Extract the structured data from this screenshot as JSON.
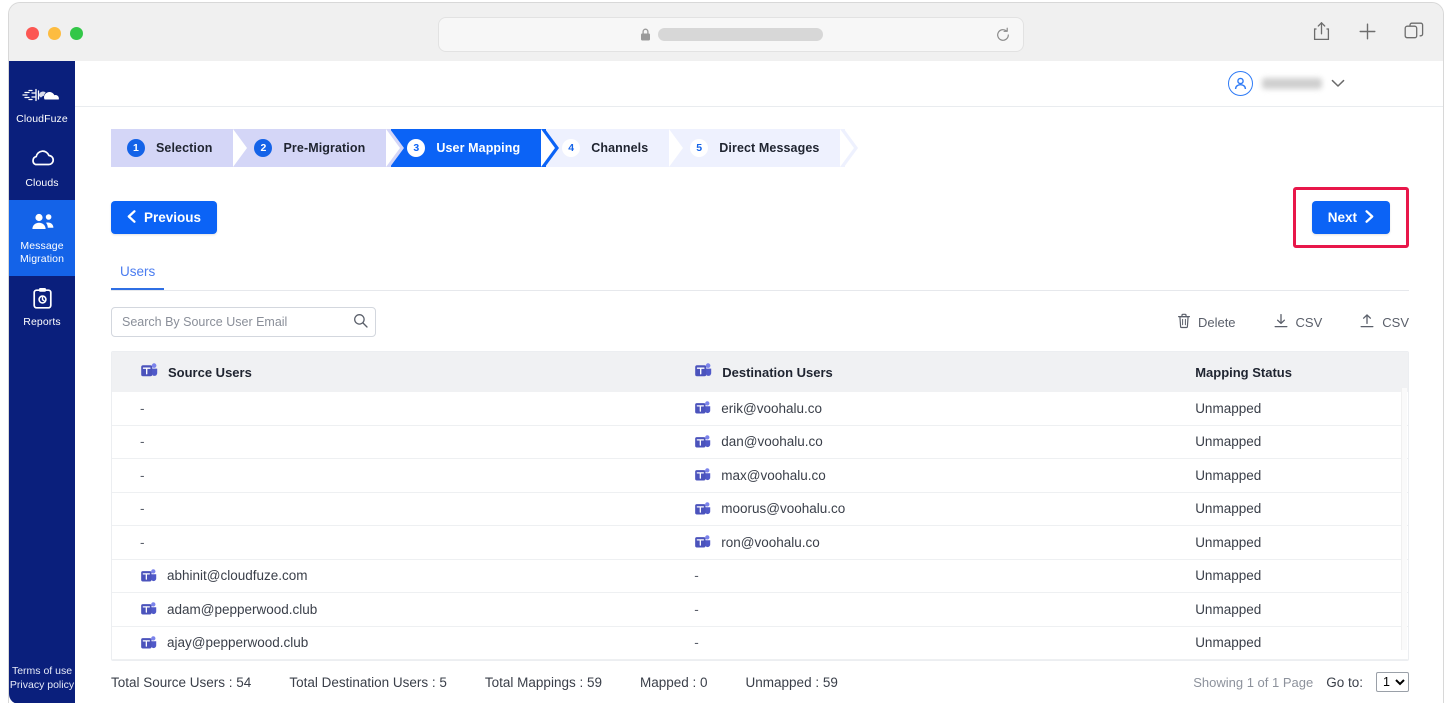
{
  "browser": {
    "traffic_lights": [
      "close-red",
      "minimize-amber",
      "maximize-green"
    ],
    "url_value": "",
    "url_redacted": true,
    "lock_icon": "lock-icon",
    "reload_icon": "reload-icon",
    "share_icon": "share-icon",
    "new_tab_icon": "plus-icon",
    "tabs_icon": "copy-tabs-icon"
  },
  "sidebar": {
    "brand": {
      "label": "CloudFuze",
      "icon": "cloudfuze-logo-icon"
    },
    "items": [
      {
        "label": "Clouds",
        "icon": "cloud-icon",
        "active": false
      },
      {
        "label": "Message\nMigration",
        "line1": "Message",
        "line2": "Migration",
        "icon": "users-group-icon",
        "active": true
      },
      {
        "label": "Reports",
        "icon": "clipboard-report-icon",
        "active": false
      }
    ],
    "legal": [
      "Terms of use",
      "Privacy policy"
    ],
    "bg_color": "#0a1f7c",
    "active_color": "#1463e8"
  },
  "header": {
    "profile": {
      "avatar_icon": "user-avatar-icon",
      "username": "",
      "username_redacted": true,
      "chevron": "chevron-down-icon"
    }
  },
  "stepper": {
    "steps": [
      {
        "num": "1",
        "label": "Selection",
        "state": "done"
      },
      {
        "num": "2",
        "label": "Pre-Migration",
        "state": "done"
      },
      {
        "num": "3",
        "label": "User Mapping",
        "state": "current"
      },
      {
        "num": "4",
        "label": "Channels",
        "state": "todo"
      },
      {
        "num": "5",
        "label": "Direct Messages",
        "state": "todo"
      }
    ],
    "colors": {
      "done": "#d4d6f7",
      "current": "#0b63f6",
      "todo": "#eef1fe",
      "accent": "#1463e8"
    }
  },
  "nav_buttons": {
    "previous_label": "Previous",
    "previous_icon": "chevron-left-icon",
    "next_label": "Next",
    "next_icon": "chevron-right-icon",
    "next_highlighted": true,
    "highlight_color": "#e8174a"
  },
  "tabs": [
    {
      "label": "Users",
      "active": true
    }
  ],
  "toolbar": {
    "search_placeholder": "Search By Source User Email",
    "search_value": "",
    "search_icon": "search-icon",
    "actions": [
      {
        "label": "Delete",
        "icon": "trash-icon"
      },
      {
        "label": "CSV",
        "icon": "download-icon"
      },
      {
        "label": "CSV",
        "icon": "upload-icon"
      }
    ]
  },
  "table": {
    "columns": [
      {
        "label": "Source Users",
        "icon": "microsoft-teams-icon"
      },
      {
        "label": "Destination Users",
        "icon": "microsoft-teams-icon"
      },
      {
        "label": "Mapping Status",
        "icon": null
      }
    ],
    "rows": [
      {
        "source": "-",
        "source_icon": false,
        "destination": "erik@voohalu.co",
        "destination_icon": true,
        "status": "Unmapped"
      },
      {
        "source": "-",
        "source_icon": false,
        "destination": "dan@voohalu.co",
        "destination_icon": true,
        "status": "Unmapped"
      },
      {
        "source": "-",
        "source_icon": false,
        "destination": "max@voohalu.co",
        "destination_icon": true,
        "status": "Unmapped"
      },
      {
        "source": "-",
        "source_icon": false,
        "destination": "moorus@voohalu.co",
        "destination_icon": true,
        "status": "Unmapped"
      },
      {
        "source": "-",
        "source_icon": false,
        "destination": "ron@voohalu.co",
        "destination_icon": true,
        "status": "Unmapped"
      },
      {
        "source": "abhinit@cloudfuze.com",
        "source_icon": true,
        "destination": "-",
        "destination_icon": false,
        "status": "Unmapped"
      },
      {
        "source": "adam@pepperwood.club",
        "source_icon": true,
        "destination": "-",
        "destination_icon": false,
        "status": "Unmapped"
      },
      {
        "source": "ajay@pepperwood.club",
        "source_icon": true,
        "destination": "-",
        "destination_icon": false,
        "status": "Unmapped"
      }
    ]
  },
  "footer": {
    "totals": [
      "Total Source Users : 54",
      "Total Destination Users : 5",
      "Total Mappings : 59",
      "Mapped : 0",
      "Unmapped : 59"
    ],
    "showing": "Showing 1 of 1 Page",
    "goto_label": "Go to:",
    "goto_value": "1",
    "goto_options": [
      "1"
    ]
  }
}
